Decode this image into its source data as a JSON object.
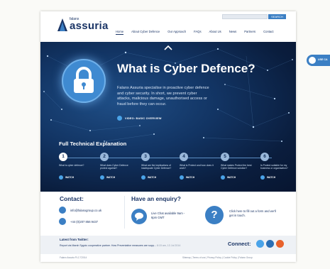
{
  "header": {
    "logo_small": "falanx",
    "logo_big": "assuria",
    "search_button": "SEARCH",
    "nav": [
      "Home",
      "About Cyber Defence",
      "Our Approach",
      "FAQs",
      "About Us",
      "News",
      "Partners",
      "Contact"
    ]
  },
  "hero": {
    "title": "What is Cyber Defence?",
    "description": "Falanx Assuria specialise in proactive cyber defence and cyber security. In short, we prevent cyber attacks, malicious damage, unauthorised access or fraud before they can occur.",
    "video_label": "VIDEO: BASIC OVERVIEW",
    "side_tab_label": "USE CA",
    "tech_title": "Full Technical Explanation",
    "steps": [
      {
        "num": "1",
        "text": "What is cyber defence?",
        "watch": "WATCH"
      },
      {
        "num": "2",
        "text": "What does Cyber Defence protect against?",
        "watch": "WATCH"
      },
      {
        "num": "3",
        "text": "What are the implications of inadequate Cyber Defence?",
        "watch": "WATCH"
      },
      {
        "num": "4",
        "text": "What is Protect and how does it work?",
        "watch": "WATCH"
      },
      {
        "num": "5",
        "text": "What makes Protect the best Cyber Defence solution?",
        "watch": "WATCH"
      },
      {
        "num": "6",
        "text": "Is Protect suitable for my business or organisation?",
        "watch": "WATCH"
      }
    ]
  },
  "contact": {
    "title": "Contact:",
    "email": "info@falanxgroup.co.uk",
    "phone": "+44 (0)207 856 9437",
    "enquiry_title": "Have an enquiry?",
    "live_chat": "Live Chat available 9am - 6pm GMT",
    "form_link": "Click here to fill out a form and we'll get in touch."
  },
  "twitter": {
    "title": "Latest from Twitter:",
    "tweet": "Report via Marsh Sygnic cooperative partner. How Preventative measures are supp... ",
    "tweet_time": "8:15 am, 13 Jul 2014",
    "connect_label": "Connect:"
  },
  "footer": {
    "left": "Falanx Assuria PLC ©2014",
    "links": "Sitemap  |  Terms of use  |  Privacy Policy  |  Cookie Policy  |  Falanx Group"
  },
  "colors": {
    "brand_navy": "#1b3566",
    "accent_blue": "#3b7fc4",
    "hero_dark": "#0a1d3d",
    "twitter_blue": "#4aa3e8",
    "linkedin_blue": "#2b6fb5",
    "rss_orange": "#e8622c"
  }
}
